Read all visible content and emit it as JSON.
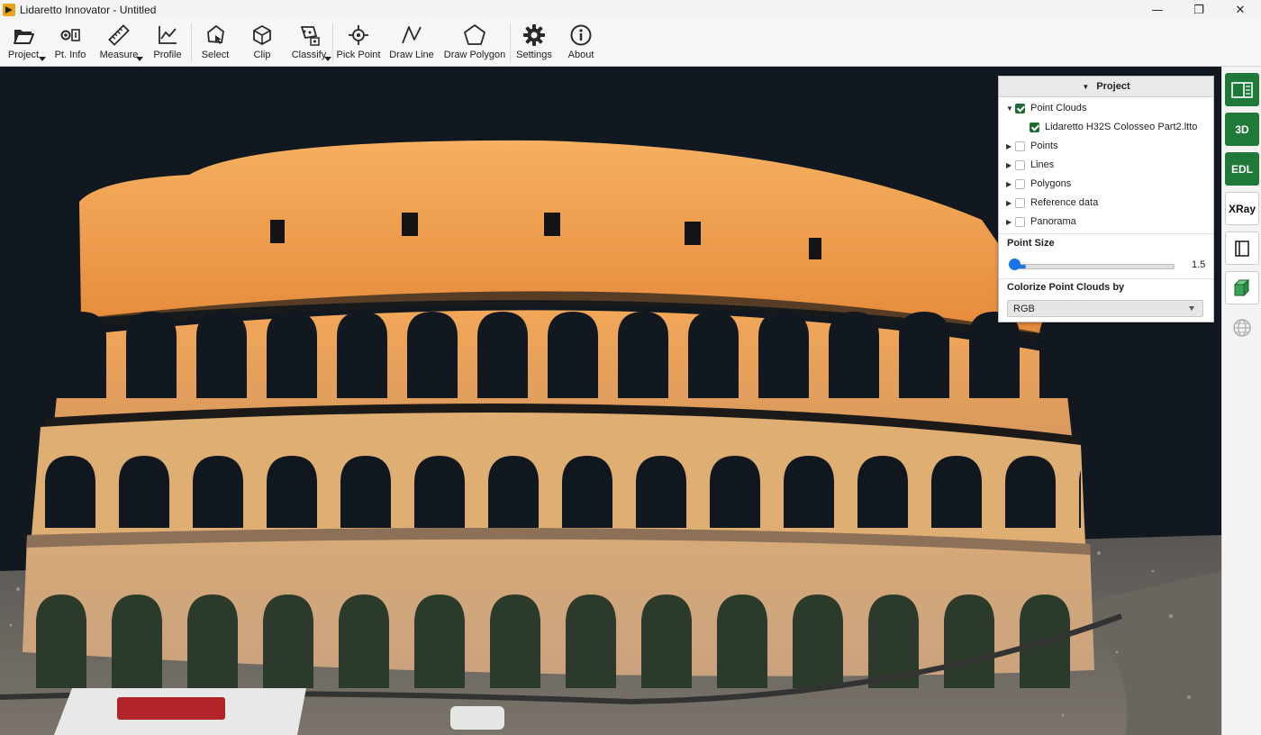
{
  "window": {
    "title": "Lidaretto Innovator - Untitled",
    "controls": {
      "minimize": "—",
      "maximize": "❐",
      "close": "✕"
    }
  },
  "toolbar": {
    "project": "Project",
    "pt_info": "Pt. Info",
    "measure": "Measure",
    "profile": "Profile",
    "select": "Select",
    "clip": "Clip",
    "classify": "Classify",
    "pick_point": "Pick Point",
    "draw_line": "Draw Line",
    "draw_polygon": "Draw Polygon",
    "settings": "Settings",
    "about": "About"
  },
  "sidebar": {
    "buttons": [
      "3D",
      "EDL",
      "XRay"
    ]
  },
  "project_panel": {
    "title": "Project",
    "tree": {
      "point_clouds": {
        "label": "Point Clouds",
        "checked": true
      },
      "cloud_file": {
        "label": "Lidaretto H32S Colosseo Part2.ltto",
        "checked": true
      },
      "points": {
        "label": "Points",
        "checked": false
      },
      "lines": {
        "label": "Lines",
        "checked": false
      },
      "polygons": {
        "label": "Polygons",
        "checked": false
      },
      "reference_data": {
        "label": "Reference data",
        "checked": false
      },
      "panorama": {
        "label": "Panorama",
        "checked": false
      }
    },
    "point_size_label": "Point Size",
    "point_size_value": "1.5",
    "colorize_label": "Colorize Point Clouds by",
    "colorize_value": "RGB"
  },
  "colors": {
    "accent_green": "#1f7a3a",
    "slider_blue": "#1a73e8"
  }
}
